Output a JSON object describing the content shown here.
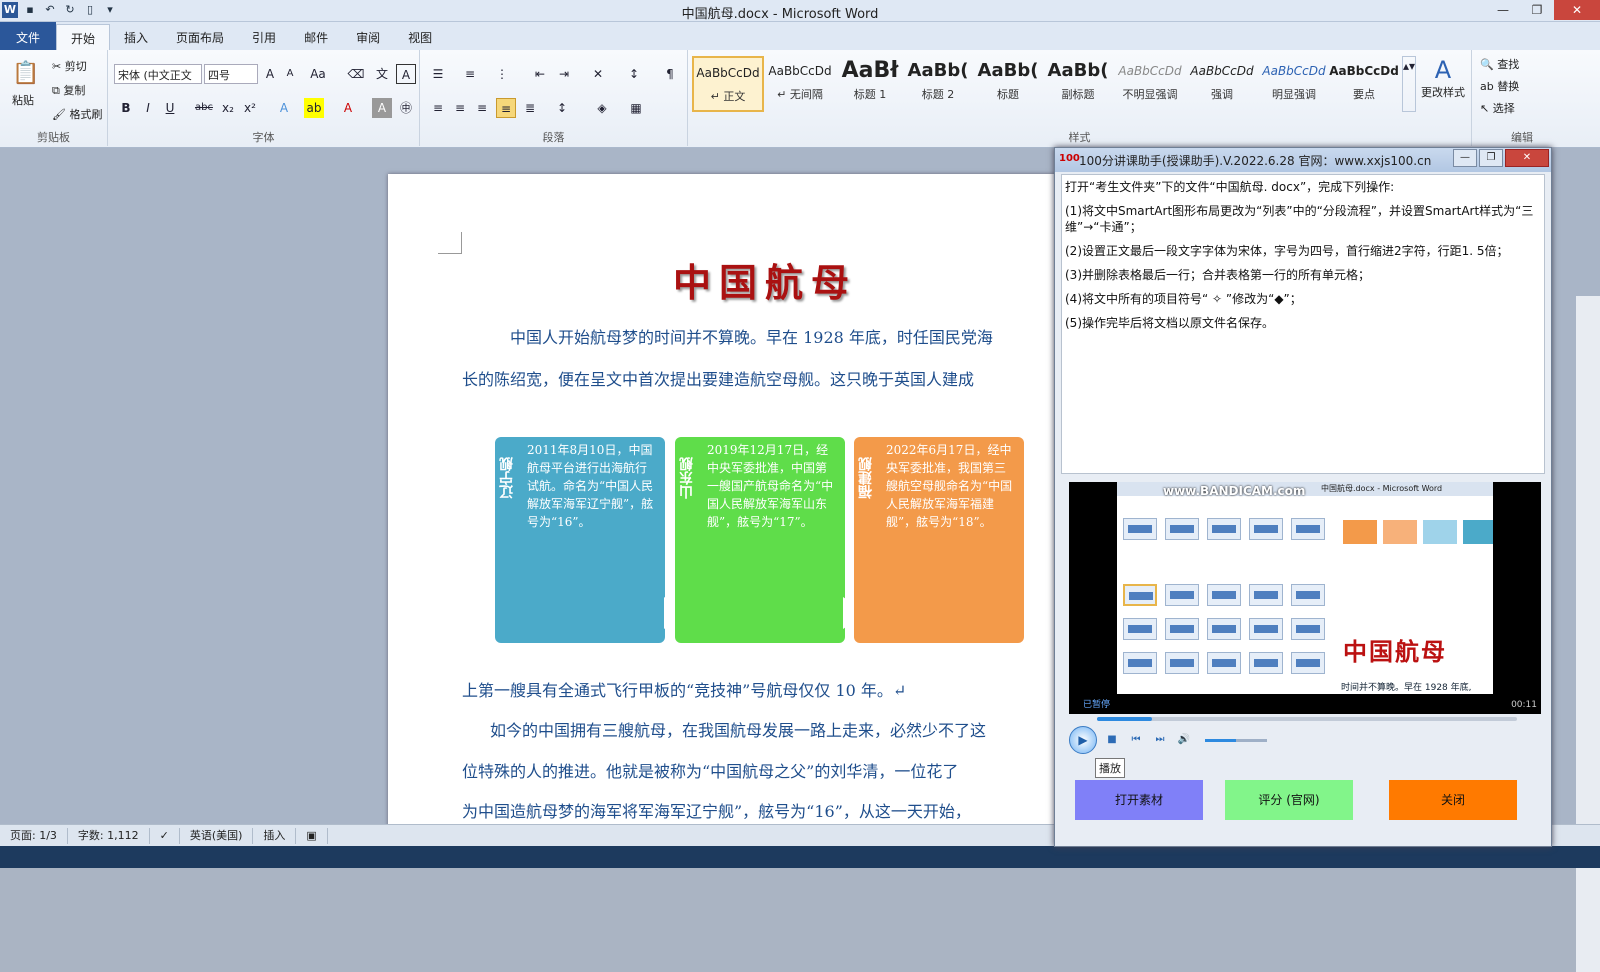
{
  "window": {
    "title": "中国航母.docx - Microsoft Word"
  },
  "tabs": [
    "文件",
    "开始",
    "插入",
    "页面布局",
    "引用",
    "邮件",
    "审阅",
    "视图"
  ],
  "ribbon": {
    "clipboard": {
      "label": "剪贴板",
      "paste": "粘贴",
      "cut": "剪切",
      "copy": "复制",
      "format_painter": "格式刷"
    },
    "font": {
      "label": "字体",
      "font_name": "宋体 (中文正文",
      "font_size": "四号"
    },
    "paragraph": {
      "label": "段落"
    },
    "styles": {
      "label": "样式",
      "items": [
        {
          "sample": "AaBbCcDd",
          "name": "↵ 正文"
        },
        {
          "sample": "AaBbCcDd",
          "name": "↵ 无间隔"
        },
        {
          "sample": "AaBł",
          "name": "标题 1"
        },
        {
          "sample": "AaBb(",
          "name": "标题 2"
        },
        {
          "sample": "AaBb(",
          "name": "标题"
        },
        {
          "sample": "AaBb(",
          "name": "副标题"
        },
        {
          "sample": "AaBbCcDd",
          "name": "不明显强调"
        },
        {
          "sample": "AaBbCcDd",
          "name": "强调"
        },
        {
          "sample": "AaBbCcDd",
          "name": "明显强调"
        },
        {
          "sample": "AaBbCcDd",
          "name": "要点"
        }
      ],
      "change": "更改样式"
    },
    "editing": {
      "label": "编辑",
      "find": "查找",
      "replace": "替换",
      "select": "选择"
    }
  },
  "document": {
    "title": "中国航母",
    "p1_line1": "中国人开始航母梦的时间并不算晚。早在 1928 年底，时任国民党海",
    "p1_line2": "长的陈绍宽，便在呈文中首次提出要建造航空母舰。这只晚于英国人建成",
    "smartart": [
      {
        "label": "辽宁舰",
        "text": "2011年8月10日，中国航母平台进行出海航行试航。命名为“中国人民解放军海军辽宁舰”，舷号为“16”。",
        "color": "#4baac9"
      },
      {
        "label": "山东舰",
        "text": "2019年12月17日，经中央军委批准，中国第一艘国产航母命名为“中国人民解放军海军山东舰”，舷号为“17”。",
        "color": "#5fdd4a"
      },
      {
        "label": "福建舰",
        "text": "2022年6月17日，经中央军委批准，我国第三艘航空母舰命名为“中国人民解放军海军福建舰”，舷号为“18”。",
        "color": "#f39a4a"
      }
    ],
    "p2": "上第一艘具有全通式飞行甲板的“竞技神”号航母仅仅 10 年。↵",
    "p3_line1": "如今的中国拥有三艘航母，在我国航母发展一路上走来，必然少不了这",
    "p3_line2": "位特殊的人的推进。他就是被称为“中国航母之父”的刘华清，一位花了",
    "p3_line3": "为中国造航母梦的海军将军海军辽宁舰”，舷号为“16”，从这一天开始，"
  },
  "status": {
    "page": "页面: 1/3",
    "words": "字数: 1,112",
    "lang": "英语(美国)",
    "mode": "插入"
  },
  "helper": {
    "title": "100分讲课助手(授课助手).V.2022.6.28  官网：www.xxjs100.cn",
    "intro": "打开“考生文件夹”下的文件“中国航母. docx”，完成下列操作:",
    "tasks": [
      "(1)将文中SmartArt图形布局更改为“列表”中的“分段流程”，并设置SmartArt样式为“三维”→“卡通”；",
      "(2)设置正文最后一段文字字体为宋体，字号为四号，首行缩进2字符，行距1. 5倍；",
      "(3)并删除表格最后一行；合并表格第一行的所有单元格；",
      "(4)将文中所有的项目符号“ ✧ ”修改为“◆”；",
      "(5)操作完毕后将文档以原文件名保存。"
    ],
    "video": {
      "watermark": "www.BANDICAM.com",
      "app_title": "中国航母.docx - Microsoft Word",
      "doc_title": "中国航母",
      "caption": "时间并不算晚。早在 1928 年底,",
      "status": "已暂停",
      "time": "00:11",
      "progress": 0.13,
      "volume": 0.5
    },
    "tooltip": "播放",
    "buttons": {
      "open": "打开素材",
      "score": "评分 (官网)",
      "close": "关闭"
    }
  }
}
